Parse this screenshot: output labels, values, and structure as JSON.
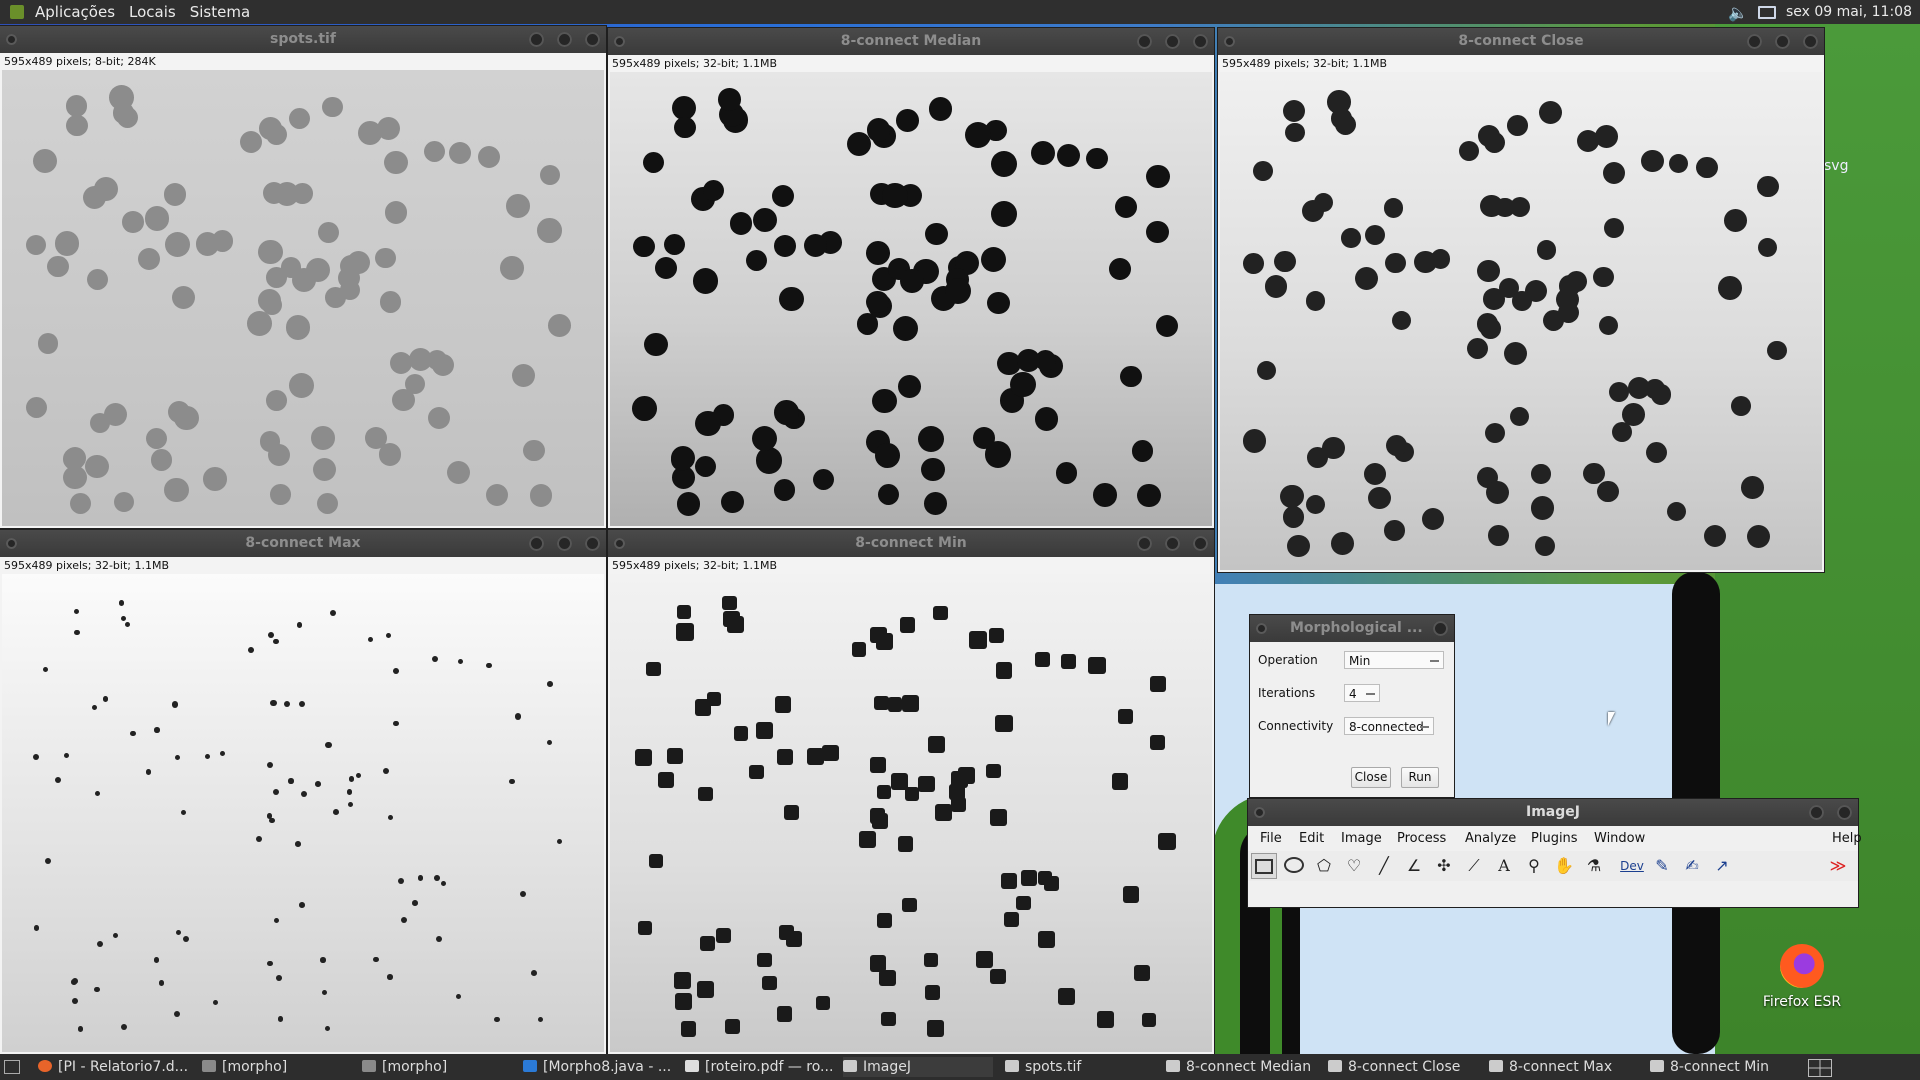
{
  "top_panel": {
    "menus": [
      "Aplicações",
      "Locais",
      "Sistema"
    ],
    "clock": "sex 09 mai, 11:08"
  },
  "desktop": {
    "svg_label": "svg",
    "firefox_label": "Firefox ESR"
  },
  "windows": {
    "spots": {
      "title": "spots.tif",
      "info": "595x489 pixels; 8-bit; 284K"
    },
    "median": {
      "title": "8-connect Median",
      "info": "595x489 pixels; 32-bit; 1.1MB"
    },
    "close": {
      "title": "8-connect Close",
      "info": "595x489 pixels; 32-bit; 1.1MB"
    },
    "max": {
      "title": "8-connect Max",
      "info": "595x489 pixels; 32-bit; 1.1MB"
    },
    "min": {
      "title": "8-connect Min",
      "info": "595x489 pixels; 32-bit; 1.1MB"
    }
  },
  "dialog": {
    "title": "Morphological ...",
    "operation_label": "Operation",
    "operation_value": "Min",
    "iterations_label": "Iterations",
    "iterations_value": "4",
    "connectivity_label": "Connectivity",
    "connectivity_value": "8-connected",
    "close_button": "Close",
    "run_button": "Run"
  },
  "imagej": {
    "title": "ImageJ",
    "menus": [
      "File",
      "Edit",
      "Image",
      "Process",
      "Analyze",
      "Plugins",
      "Window",
      "Help"
    ],
    "tools": [
      "rectangle-icon",
      "oval-icon",
      "polygon-icon",
      "freehand-icon",
      "line-icon",
      "angle-icon",
      "point-icon",
      "wand-icon",
      "text-icon",
      "magnifier-icon",
      "hand-icon",
      "dropper-icon",
      "dev-icon",
      "pencil-icon",
      "brush-icon",
      "arrow-icon",
      "empty-slot-icon",
      "empty-slot-icon",
      "more-tools-icon"
    ],
    "dev_label": "Dev",
    "text_tool_glyph": "A",
    "more_glyph": "≫"
  },
  "taskbar": {
    "items": [
      "[PI - Relatorio7.d...",
      "[morpho]",
      "[morpho]",
      "[Morpho8.java - ...",
      "[roteiro.pdf — ro...",
      "ImageJ",
      "spots.tif",
      "8-connect Median",
      "8-connect Close",
      "8-connect Max",
      "8-connect Min"
    ]
  }
}
